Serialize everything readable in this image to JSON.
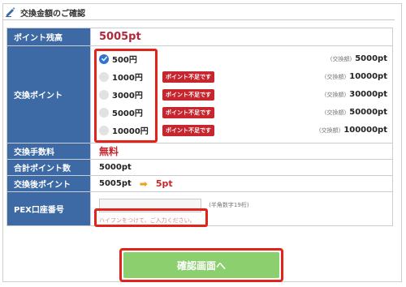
{
  "header": {
    "title": "交換金額のご確認",
    "icon": "pen-icon"
  },
  "balance": {
    "label": "ポイント残高",
    "value": "5005pt"
  },
  "exchange": {
    "label": "交換ポイント",
    "options": [
      {
        "amount": "500円",
        "checked": true,
        "warning": "",
        "kind": "(交換額)",
        "points": "5000pt"
      },
      {
        "amount": "1000円",
        "checked": false,
        "warning": "ポイント不足です",
        "kind": "(交換額)",
        "points": "10000pt"
      },
      {
        "amount": "3000円",
        "checked": false,
        "warning": "ポイント不足です",
        "kind": "(交換額)",
        "points": "30000pt"
      },
      {
        "amount": "5000円",
        "checked": false,
        "warning": "ポイント不足です",
        "kind": "(交換額)",
        "points": "50000pt"
      },
      {
        "amount": "10000円",
        "checked": false,
        "warning": "ポイント不足です",
        "kind": "(交換額)",
        "points": "100000pt"
      }
    ]
  },
  "fee": {
    "label": "交換手数料",
    "value": "無料"
  },
  "total": {
    "label": "合計ポイント数",
    "value": "5000pt"
  },
  "after": {
    "label": "交換後ポイント",
    "before": "5005pt",
    "arrow": "➡",
    "after": "5pt"
  },
  "pex": {
    "label": "PEX口座番号",
    "value": "",
    "note": "(半角数字19桁)",
    "help": "ハイフンをつけて、ご入力ください。"
  },
  "submit": {
    "label": "確認画面へ"
  },
  "colors": {
    "label_bg": "#3d6aa5",
    "accent_red": "#c8262e",
    "highlight": "#e2231a",
    "submit_bg": "#8ccf6e",
    "radio_checked": "#2f74d0"
  }
}
